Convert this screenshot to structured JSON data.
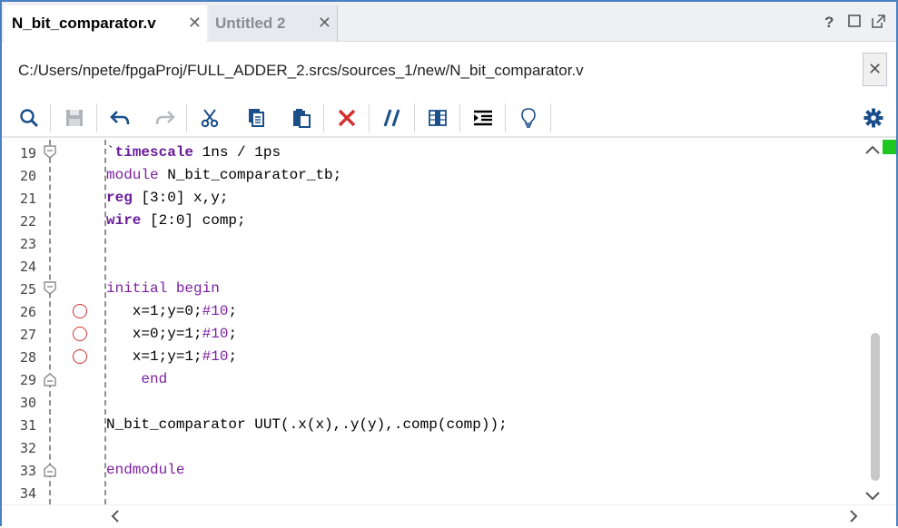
{
  "tabs": [
    {
      "label": "N_bit_comparator.v",
      "active": true
    },
    {
      "label": "Untitled 2",
      "active": false
    }
  ],
  "window_controls": {
    "help": "?"
  },
  "path": "C:/Users/npete/fpgaProj/FULL_ADDER_2.srcs/sources_1/new/N_bit_comparator.v",
  "toolbar": {
    "icons": [
      "search-icon",
      "save-icon",
      "undo-icon",
      "redo-icon",
      "cut-icon",
      "copy-icon",
      "paste-icon",
      "delete-icon",
      "comment-icon",
      "column-select-icon",
      "indent-icon",
      "hint-bulb-icon",
      "settings-gear-icon"
    ]
  },
  "colors": {
    "accent": "#4a7fc1",
    "keyword": "#7b1fa2",
    "breakpoint": "#d32f2f",
    "marker": "#1ec81e"
  },
  "editor": {
    "lines": [
      {
        "n": "19"
      },
      {
        "n": "20"
      },
      {
        "n": "21"
      },
      {
        "n": "22"
      },
      {
        "n": "23"
      },
      {
        "n": "24"
      },
      {
        "n": "25"
      },
      {
        "n": "26"
      },
      {
        "n": "27"
      },
      {
        "n": "28"
      },
      {
        "n": "29"
      },
      {
        "n": "30"
      },
      {
        "n": "31"
      },
      {
        "n": "32"
      },
      {
        "n": "33"
      },
      {
        "n": "34"
      }
    ],
    "code": {
      "l19a": "`",
      "l19b": "timescale",
      "l19c": " 1ns / 1ps",
      "l20a": "module",
      "l20b": " N_bit_comparator_tb;",
      "l21a": "reg",
      "l21b": " [3:0] x,y;",
      "l22a": "wire",
      "l22b": " [2:0] comp;",
      "l25a": "initial",
      "l25b": " ",
      "l25c": "begin",
      "l26a": "   x=1;y=0;",
      "l26b": "#10",
      "l26c": ";",
      "l27a": "   x=0;y=1;",
      "l27b": "#10",
      "l27c": ";",
      "l28a": "   x=1;y=1;",
      "l28b": "#10",
      "l28c": ";",
      "l29a": "    end",
      "l31a": "N_bit_comparator UUT(.x(x),.y(y),.comp(comp));",
      "l33a": "endmodule"
    }
  }
}
